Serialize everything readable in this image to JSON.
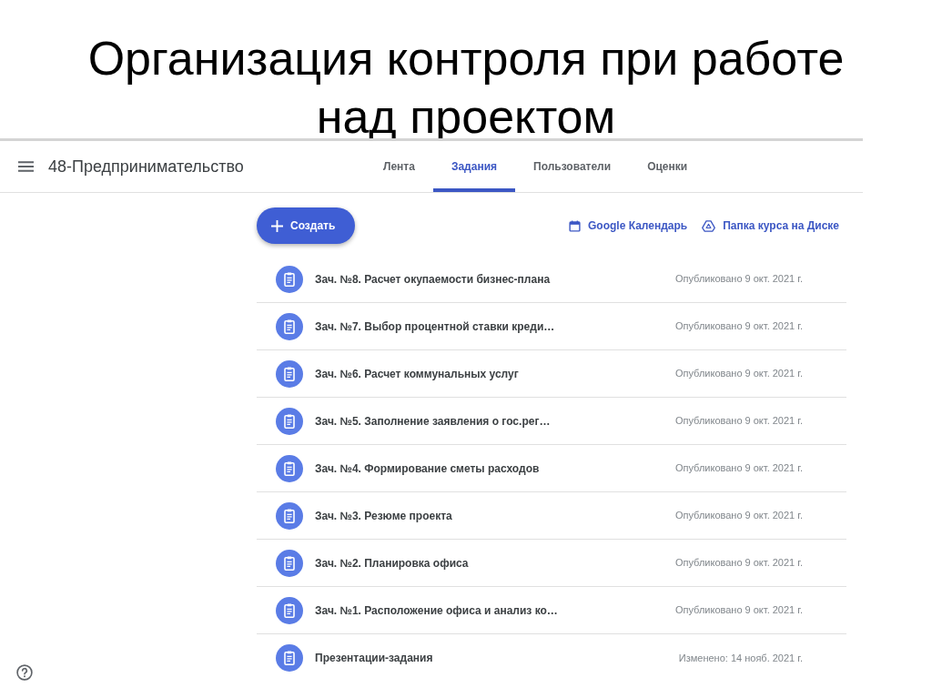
{
  "slide": {
    "title": "Организация контроля при работе над проектом"
  },
  "classroom": {
    "course_title": "48-Предпринимательство",
    "tabs": [
      {
        "label": "Лента",
        "selected": false
      },
      {
        "label": "Задания",
        "selected": true
      },
      {
        "label": "Пользователи",
        "selected": false
      },
      {
        "label": "Оценки",
        "selected": false
      }
    ],
    "create_button": {
      "label": "Создать"
    },
    "links": [
      {
        "kind": "calendar",
        "label": "Google Календарь"
      },
      {
        "kind": "drive",
        "label": "Папка курса на Диске"
      }
    ],
    "items": [
      {
        "title": "Зач. №8. Расчет окупаемости бизнес-плана",
        "status": "Опубликовано 9 окт. 2021 г."
      },
      {
        "title": "Зач. №7. Выбор процентной ставки креди…",
        "status": "Опубликовано 9 окт. 2021 г."
      },
      {
        "title": "Зач. №6. Расчет коммунальных услуг",
        "status": "Опубликовано 9 окт. 2021 г."
      },
      {
        "title": "Зач. №5. Заполнение заявления о гос.рег…",
        "status": "Опубликовано 9 окт. 2021 г."
      },
      {
        "title": "Зач. №4. Формирование сметы расходов",
        "status": "Опубликовано 9 окт. 2021 г."
      },
      {
        "title": "Зач. №3. Резюме проекта",
        "status": "Опубликовано 9 окт. 2021 г."
      },
      {
        "title": "Зач. №2. Планировка офиса",
        "status": "Опубликовано 9 окт. 2021 г."
      },
      {
        "title": "Зач. №1. Расположение офиса и анализ ко…",
        "status": "Опубликовано 9 окт. 2021 г."
      },
      {
        "title": "Презентации-задания",
        "status": "Изменено: 14 нояб. 2021 г."
      }
    ]
  }
}
